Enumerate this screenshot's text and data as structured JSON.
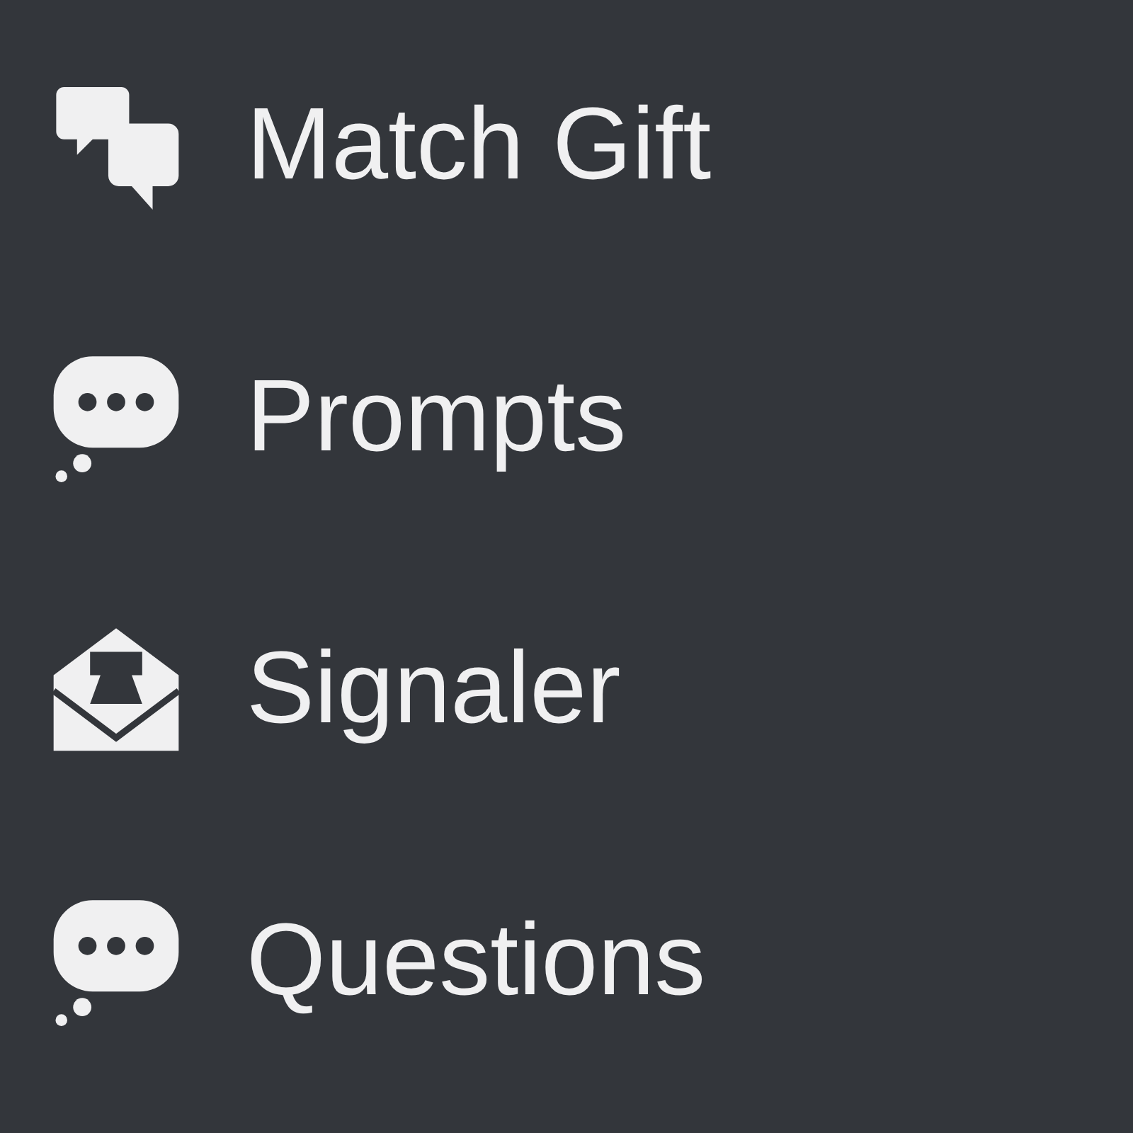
{
  "menu": {
    "items": [
      {
        "label": "Match Gift",
        "kind": "comments"
      },
      {
        "label": "Prompts",
        "kind": "thought"
      },
      {
        "label": "Signaler",
        "kind": "envelope"
      },
      {
        "label": "Questions",
        "kind": "thought"
      }
    ]
  }
}
